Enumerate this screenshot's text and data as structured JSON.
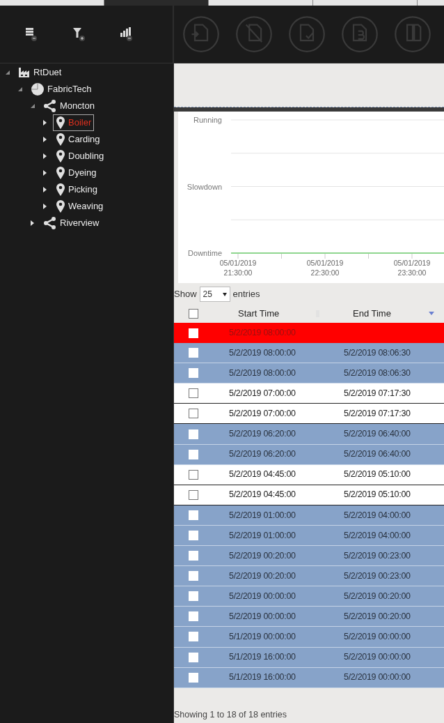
{
  "top_tabs": [
    {
      "selected": false
    },
    {
      "selected": true
    },
    {
      "selected": false
    },
    {
      "selected": false
    },
    {
      "selected": false
    }
  ],
  "toolbar": {
    "left": [
      {
        "kind": "layers-minus",
        "disabled": false
      },
      {
        "kind": "filter-plus",
        "disabled": false
      },
      {
        "kind": "bars-minus",
        "disabled": false
      }
    ],
    "right": [
      {
        "kind": "doc-in",
        "disabled": true
      },
      {
        "kind": "doc-off",
        "disabled": true
      },
      {
        "kind": "doc-check",
        "disabled": true
      },
      {
        "kind": "doc-b",
        "disabled": true
      },
      {
        "kind": "doc-split",
        "disabled": true
      }
    ]
  },
  "tree": [
    {
      "label": "RtDuet",
      "kind": "enterprise",
      "expanded": true,
      "selected": false,
      "children": [
        {
          "label": "FabricTech",
          "kind": "company",
          "expanded": true,
          "selected": false,
          "children": [
            {
              "label": "Moncton",
              "kind": "site",
              "expanded": true,
              "selected": false,
              "children": [
                {
                  "label": "Boiler",
                  "kind": "line",
                  "expanded": false,
                  "selected": true
                },
                {
                  "label": "Carding",
                  "kind": "line",
                  "expanded": false,
                  "selected": false
                },
                {
                  "label": "Doubling",
                  "kind": "line",
                  "expanded": false,
                  "selected": false
                },
                {
                  "label": "Dyeing",
                  "kind": "line",
                  "expanded": false,
                  "selected": false
                },
                {
                  "label": "Picking",
                  "kind": "line",
                  "expanded": false,
                  "selected": false
                },
                {
                  "label": "Weaving",
                  "kind": "line",
                  "expanded": false,
                  "selected": false
                }
              ]
            },
            {
              "label": "Riverview",
              "kind": "site",
              "expanded": false,
              "selected": false
            }
          ]
        }
      ]
    }
  ],
  "state_chart": {
    "y_labels": [
      "Running",
      "Slowdown",
      "Downtime"
    ],
    "x_labels": [
      [
        "05/01/2019",
        "21:30:00"
      ],
      [
        "05/01/2019",
        "22:30:00"
      ],
      [
        "05/01/2019",
        "23:30:00"
      ]
    ]
  },
  "table": {
    "show_label": "Show",
    "page_size": "25",
    "entries_label": "entries",
    "select_all_checked": false,
    "columns": [
      {
        "label": "Start Time",
        "sorted": false
      },
      {
        "label": "End Time",
        "sorted": true
      }
    ],
    "rows": [
      {
        "kind": "alarm",
        "checked": false,
        "start": "5/2/2019 08:00:00"
      },
      {
        "kind": "highlighted",
        "checked": false,
        "start": "5/2/2019 08:00:00",
        "end": "5/2/2019 08:06:30"
      },
      {
        "kind": "highlighted",
        "checked": false,
        "start": "5/2/2019 08:00:00",
        "end": "5/2/2019 08:06:30"
      },
      {
        "kind": "plain",
        "checked": false,
        "start": "5/2/2019 07:00:00",
        "end": "5/2/2019 07:17:30"
      },
      {
        "kind": "plain",
        "checked": false,
        "start": "5/2/2019 07:00:00",
        "end": "5/2/2019 07:17:30"
      },
      {
        "kind": "highlighted",
        "checked": false,
        "start": "5/2/2019 06:20:00",
        "end": "5/2/2019 06:40:00"
      },
      {
        "kind": "highlighted",
        "checked": false,
        "start": "5/2/2019 06:20:00",
        "end": "5/2/2019 06:40:00"
      },
      {
        "kind": "plain",
        "checked": false,
        "start": "5/2/2019 04:45:00",
        "end": "5/2/2019 05:10:00"
      },
      {
        "kind": "plain",
        "checked": false,
        "start": "5/2/2019 04:45:00",
        "end": "5/2/2019 05:10:00"
      },
      {
        "kind": "highlighted",
        "checked": false,
        "start": "5/2/2019 01:00:00",
        "end": "5/2/2019 04:00:00"
      },
      {
        "kind": "highlighted",
        "checked": false,
        "start": "5/2/2019 01:00:00",
        "end": "5/2/2019 04:00:00"
      },
      {
        "kind": "highlighted",
        "checked": false,
        "start": "5/2/2019 00:20:00",
        "end": "5/2/2019 00:23:00"
      },
      {
        "kind": "highlighted",
        "checked": false,
        "start": "5/2/2019 00:20:00",
        "end": "5/2/2019 00:23:00"
      },
      {
        "kind": "highlighted",
        "checked": false,
        "start": "5/2/2019 00:00:00",
        "end": "5/2/2019 00:20:00"
      },
      {
        "kind": "highlighted",
        "checked": false,
        "start": "5/2/2019 00:00:00",
        "end": "5/2/2019 00:20:00"
      },
      {
        "kind": "highlighted",
        "checked": false,
        "start": "5/1/2019 00:00:00",
        "end": "5/2/2019 00:00:00"
      },
      {
        "kind": "highlighted",
        "checked": false,
        "start": "5/1/2019 16:00:00",
        "end": "5/2/2019 00:00:00"
      },
      {
        "kind": "highlighted",
        "checked": false,
        "start": "5/1/2019 16:00:00",
        "end": "5/2/2019 00:00:00"
      }
    ],
    "footer": "Showing 1 to 18 of 18 entries"
  }
}
